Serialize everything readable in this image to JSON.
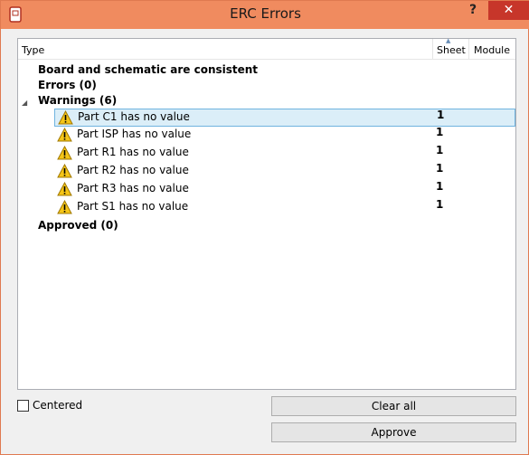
{
  "window": {
    "title": "ERC Errors",
    "help_label": "?",
    "close_label": "✕"
  },
  "columns": {
    "type": "Type",
    "sheet": "Sheet",
    "module": "Module"
  },
  "tree": {
    "consistent": "Board and schematic are consistent",
    "errors": "Errors (0)",
    "warnings": "Warnings (6)",
    "approved": "Approved (0)",
    "warning_items": [
      {
        "text": "Part C1 has no value",
        "sheet": "1",
        "selected": true
      },
      {
        "text": "Part ISP has no value",
        "sheet": "1",
        "selected": false
      },
      {
        "text": "Part R1 has no value",
        "sheet": "1",
        "selected": false
      },
      {
        "text": "Part R2 has no value",
        "sheet": "1",
        "selected": false
      },
      {
        "text": "Part R3 has no value",
        "sheet": "1",
        "selected": false
      },
      {
        "text": "Part S1 has no value",
        "sheet": "1",
        "selected": false
      }
    ]
  },
  "options": {
    "centered_label": "Centered",
    "centered_checked": false
  },
  "buttons": {
    "clear_all": "Clear all",
    "approve": "Approve"
  },
  "colors": {
    "titlebar": "#f08b5f",
    "close": "#c7362a",
    "selection": "#dbeef8",
    "warning": "#f5c518"
  }
}
